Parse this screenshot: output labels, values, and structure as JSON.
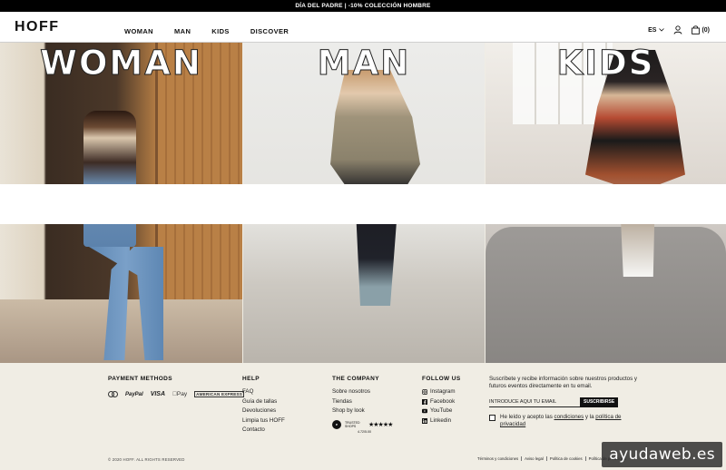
{
  "promo": {
    "text": "DÍA DEL PADRE | -10% COLECCIÓN HOMBRE"
  },
  "header": {
    "logo": "HOFF",
    "nav": [
      "WOMAN",
      "MAN",
      "KIDS",
      "DISCOVER"
    ],
    "language": "ES",
    "cart_count": "(0)"
  },
  "hero": {
    "panels": [
      {
        "label": "WOMAN"
      },
      {
        "label": "MAN"
      },
      {
        "label": "KIDS"
      }
    ]
  },
  "footer": {
    "payment": {
      "title": "PAYMENT METHODS",
      "methods": [
        "PayPal",
        "VISA",
        "Pay",
        "AMERICAN EXPRESS"
      ]
    },
    "help": {
      "title": "HELP",
      "items": [
        "FAQ",
        "Guía de tallas",
        "Devoluciones",
        "Limpia tus HOFF",
        "Contacto"
      ]
    },
    "company": {
      "title": "THE COMPANY",
      "items": [
        "Sobre nosotros",
        "Tiendas",
        "Shop by look"
      ],
      "trust_label": "TRUSTED SHOPS",
      "rating": "4.72/5.00"
    },
    "follow": {
      "title": "FOLLOW US",
      "items": [
        "Instagram",
        "Facebook",
        "YouTube",
        "Linkedin"
      ]
    },
    "newsletter": {
      "text": "Suscríbete y recibe información sobre nuestros productos y futuros eventos directamente en tu email.",
      "placeholder": "INTRODUCE AQUÍ TU EMAIL",
      "button": "SUSCRIBIRSE",
      "consent_prefix": "He leído y acepto las ",
      "consent_link1": "condiciones",
      "consent_middle": " y la ",
      "consent_link2": "política de privacidad"
    },
    "copyright": "© 2020 HOFF. ALL RIGHTS RESERVED",
    "legal": [
      "Términos y condiciones",
      "Aviso legal",
      "Política de cookies",
      "Política de privacidad"
    ]
  },
  "watermark": "ayudaweb.es"
}
